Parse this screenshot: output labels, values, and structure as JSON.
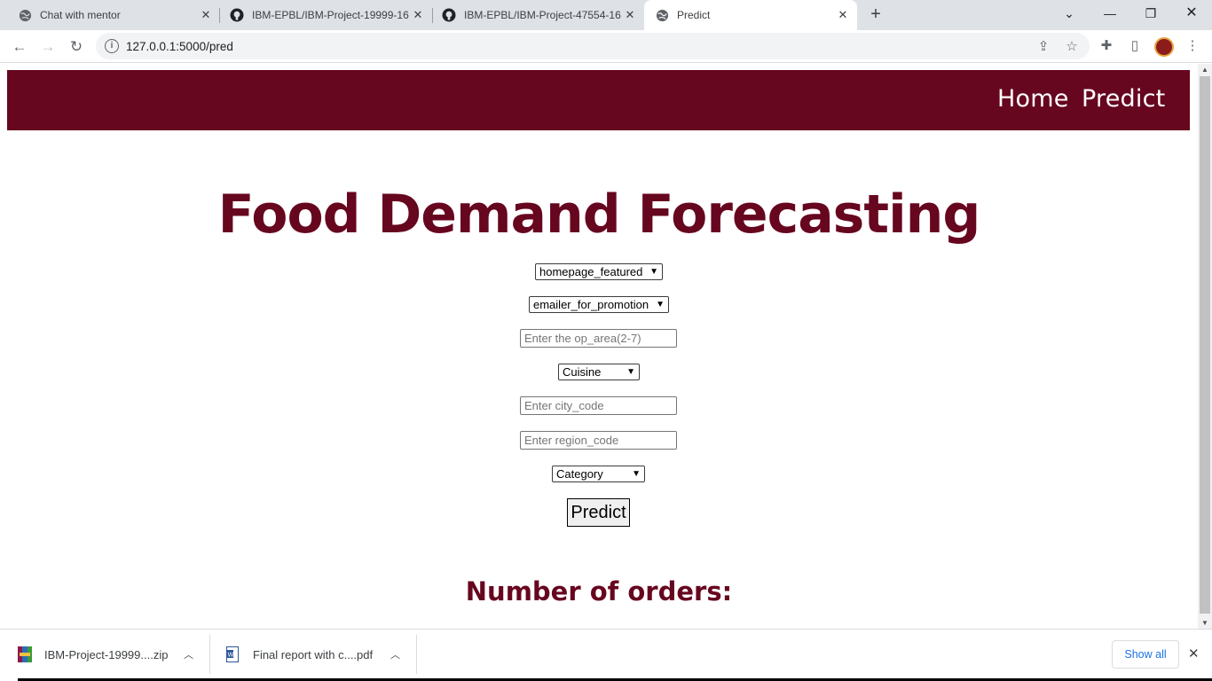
{
  "browser": {
    "tabs": [
      {
        "title": "Chat with mentor",
        "icon": "globe-icon"
      },
      {
        "title": "IBM-EPBL/IBM-Project-19999-16",
        "icon": "github-icon"
      },
      {
        "title": "IBM-EPBL/IBM-Project-47554-16",
        "icon": "github-icon"
      },
      {
        "title": "Predict",
        "icon": "globe-icon"
      }
    ],
    "url": "127.0.0.1:5000/pred"
  },
  "navbar": {
    "home": "Home",
    "predict": "Predict"
  },
  "page": {
    "title": "Food Demand Forecasting",
    "form": {
      "homepage_featured": "homepage_featured",
      "emailer_for_promotion": "emailer_for_promotion",
      "op_area_placeholder": "Enter the op_area(2-7)",
      "cuisine": "Cuisine",
      "city_code_placeholder": "Enter city_code",
      "region_code_placeholder": "Enter region_code",
      "category": "Category",
      "submit": "Predict"
    },
    "result_label": "Number of orders:"
  },
  "downloads": {
    "items": [
      {
        "name": "IBM-Project-19999....zip"
      },
      {
        "name": "Final report with c....pdf"
      }
    ],
    "show_all": "Show all"
  },
  "colors": {
    "brand": "#67061f",
    "tab_bar": "#dee1e6",
    "link": "#1a73e8"
  }
}
